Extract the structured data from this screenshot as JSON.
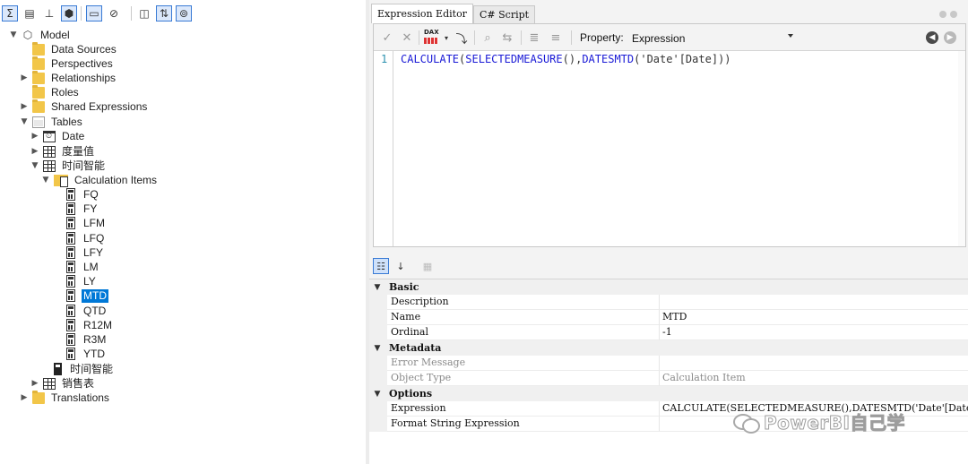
{
  "left_toolbar": {
    "icons": [
      "sigma-icon",
      "columns-icon",
      "hierarchy-icon",
      "cube-icon",
      "window-icon",
      "hidden-icon",
      "split-icon",
      "sort-icon",
      "filter-icon"
    ]
  },
  "tree": {
    "model": "Model",
    "data_sources": "Data Sources",
    "perspectives": "Perspectives",
    "relationships": "Relationships",
    "roles": "Roles",
    "shared_expressions": "Shared Expressions",
    "tables": "Tables",
    "date": "Date",
    "measures": "度量值",
    "time_intel": "时间智能",
    "calc_items": "Calculation Items",
    "items": [
      "FQ",
      "FY",
      "LFM",
      "LFQ",
      "LFY",
      "LM",
      "LY",
      "MTD",
      "QTD",
      "R12M",
      "R3M",
      "YTD"
    ],
    "selected_item": "MTD",
    "time_intel_column": "时间智能",
    "sales": "销售表",
    "translations": "Translations"
  },
  "tabs": {
    "expression_editor": "Expression Editor",
    "csharp_script": "C# Script"
  },
  "editor_toolbar": {
    "dax_label": "DAX",
    "property_label": "Property:",
    "property_value": "Expression"
  },
  "editor": {
    "line_number": "1",
    "code_fn1": "CALCULATE",
    "code_p1": "(",
    "code_fn2": "SELECTEDMEASURE",
    "code_p2": "(),",
    "code_fn3": "DATESMTD",
    "code_p3": "(",
    "code_arg": "'Date'[Date]",
    "code_p4": "))"
  },
  "property_grid": {
    "categories": {
      "basic": "Basic",
      "metadata": "Metadata",
      "options": "Options"
    },
    "rows": {
      "description": {
        "name": "Description",
        "value": ""
      },
      "name": {
        "name": "Name",
        "value": "MTD"
      },
      "ordinal": {
        "name": "Ordinal",
        "value": "-1"
      },
      "error_message": {
        "name": "Error Message",
        "value": ""
      },
      "object_type": {
        "name": "Object Type",
        "value": "Calculation Item"
      },
      "expression": {
        "name": "Expression",
        "value": "CALCULATE(SELECTEDMEASURE(),DATESMTD('Date'[Date]))"
      },
      "format_string": {
        "name": "Format String Expression",
        "value": ""
      }
    }
  },
  "watermark": {
    "text": "PowerBI自己学"
  }
}
